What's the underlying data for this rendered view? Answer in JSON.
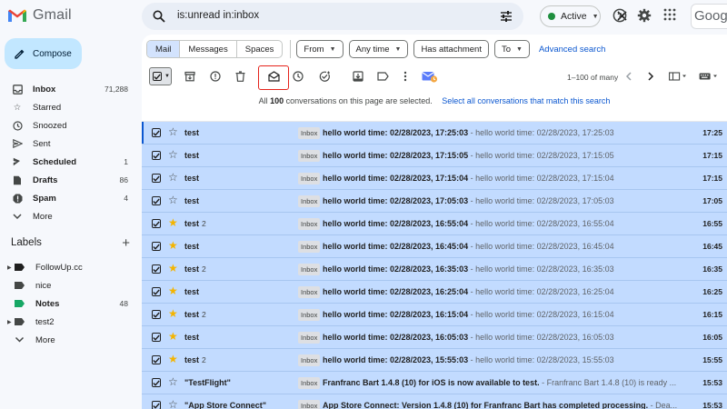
{
  "brand": {
    "name": "Gmail",
    "red": "#ea4335",
    "blue": "#4285f4",
    "green": "#34a853",
    "yellow": "#fbbc04"
  },
  "search": {
    "query": "is:unread in:inbox"
  },
  "status": {
    "label": "Active",
    "color": "#1e8e3e"
  },
  "top_right": {
    "brand_text": "Goog"
  },
  "compose": {
    "label": "Compose"
  },
  "nav": [
    {
      "label": "Inbox",
      "count": "71,288",
      "icon": "inbox-icon",
      "bold": true
    },
    {
      "label": "Starred",
      "count": "",
      "icon": "star-icon",
      "bold": false
    },
    {
      "label": "Snoozed",
      "count": "",
      "icon": "clock-icon",
      "bold": false
    },
    {
      "label": "Sent",
      "count": "",
      "icon": "send-icon",
      "bold": false
    },
    {
      "label": "Scheduled",
      "count": "1",
      "icon": "schedule-send-icon",
      "bold": true
    },
    {
      "label": "Drafts",
      "count": "86",
      "icon": "draft-icon",
      "bold": true
    },
    {
      "label": "Spam",
      "count": "4",
      "icon": "spam-icon",
      "bold": true
    },
    {
      "label": "More",
      "count": "",
      "icon": "chevron-down-icon",
      "bold": false
    }
  ],
  "labels_header": "Labels",
  "labels": [
    {
      "label": "FollowUp.cc",
      "count": "",
      "color": "#1f1f1f",
      "arrow": true,
      "bold": false
    },
    {
      "label": "nice",
      "count": "",
      "color": "#444746",
      "arrow": false,
      "bold": false
    },
    {
      "label": "Notes",
      "count": "48",
      "color": "#16a765",
      "arrow": false,
      "bold": true
    },
    {
      "label": "test2",
      "count": "",
      "color": "#444746",
      "arrow": true,
      "bold": false
    },
    {
      "label": "More",
      "count": "",
      "color": "",
      "arrow": false,
      "bold": false
    }
  ],
  "filters": {
    "tabs": [
      "Mail",
      "Messages",
      "Spaces"
    ],
    "chips": [
      "From",
      "Any time",
      "Has attachment",
      "To"
    ],
    "advanced": "Advanced search"
  },
  "pager": {
    "range": "1–100 of many"
  },
  "banner": {
    "prefix": "All",
    "count": "100",
    "suffix": "conversations on this page are selected.",
    "link": "Select all conversations that match this search"
  },
  "rows": [
    {
      "sender": "test",
      "num": "",
      "starred": false,
      "badge": "Inbox",
      "subject": "hello world time: 02/28/2023, 17:25:03",
      "snippet": " - hello world time: 02/28/2023, 17:25:03",
      "time": "17:25"
    },
    {
      "sender": "test",
      "num": "",
      "starred": false,
      "badge": "Inbox",
      "subject": "hello world time: 02/28/2023, 17:15:05",
      "snippet": " - hello world time: 02/28/2023, 17:15:05",
      "time": "17:15"
    },
    {
      "sender": "test",
      "num": "",
      "starred": false,
      "badge": "Inbox",
      "subject": "hello world time: 02/28/2023, 17:15:04",
      "snippet": " - hello world time: 02/28/2023, 17:15:04",
      "time": "17:15"
    },
    {
      "sender": "test",
      "num": "",
      "starred": false,
      "badge": "Inbox",
      "subject": "hello world time: 02/28/2023, 17:05:03",
      "snippet": " - hello world time: 02/28/2023, 17:05:03",
      "time": "17:05"
    },
    {
      "sender": "test",
      "num": "2",
      "starred": true,
      "badge": "Inbox",
      "subject": "hello world time: 02/28/2023, 16:55:04",
      "snippet": " - hello world time: 02/28/2023, 16:55:04",
      "time": "16:55"
    },
    {
      "sender": "test",
      "num": "",
      "starred": true,
      "badge": "Inbox",
      "subject": "hello world time: 02/28/2023, 16:45:04",
      "snippet": " - hello world time: 02/28/2023, 16:45:04",
      "time": "16:45"
    },
    {
      "sender": "test",
      "num": "2",
      "starred": true,
      "badge": "Inbox",
      "subject": "hello world time: 02/28/2023, 16:35:03",
      "snippet": " - hello world time: 02/28/2023, 16:35:03",
      "time": "16:35"
    },
    {
      "sender": "test",
      "num": "",
      "starred": true,
      "badge": "Inbox",
      "subject": "hello world time: 02/28/2023, 16:25:04",
      "snippet": " - hello world time: 02/28/2023, 16:25:04",
      "time": "16:25"
    },
    {
      "sender": "test",
      "num": "2",
      "starred": true,
      "badge": "Inbox",
      "subject": "hello world time: 02/28/2023, 16:15:04",
      "snippet": " - hello world time: 02/28/2023, 16:15:04",
      "time": "16:15"
    },
    {
      "sender": "test",
      "num": "",
      "starred": true,
      "badge": "Inbox",
      "subject": "hello world time: 02/28/2023, 16:05:03",
      "snippet": " - hello world time: 02/28/2023, 16:05:03",
      "time": "16:05"
    },
    {
      "sender": "test",
      "num": "2",
      "starred": true,
      "badge": "Inbox",
      "subject": "hello world time: 02/28/2023, 15:55:03",
      "snippet": " - hello world time: 02/28/2023, 15:55:03",
      "time": "15:55"
    },
    {
      "sender": "\"TestFlight\"",
      "num": "",
      "starred": false,
      "badge": "Inbox",
      "subject": "Franfranc Bart 1.4.8 (10) for iOS is now available to test.",
      "snippet": " - Franfranc Bart 1.4.8 (10) is ready ...",
      "time": "15:53"
    },
    {
      "sender": "\"App Store Connect\"",
      "num": "",
      "starred": false,
      "badge": "Inbox",
      "subject": "App Store Connect: Version 1.4.8 (10) for Franfranc Bart has completed processing.",
      "snippet": " - Dea...",
      "time": "15:53"
    }
  ]
}
